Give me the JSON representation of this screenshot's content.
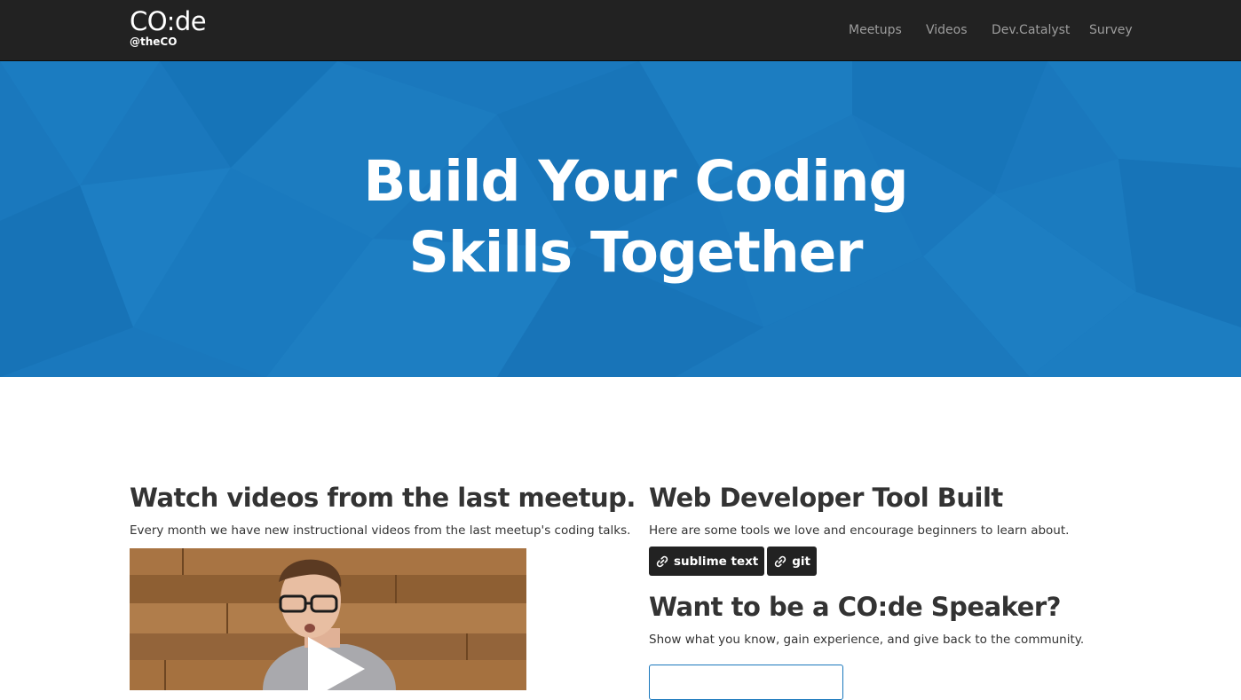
{
  "navbar": {
    "brand": {
      "name": "CO:de",
      "handle": "@theCO"
    },
    "items": [
      {
        "label": "Meetups"
      },
      {
        "label": "Videos"
      },
      {
        "label": "Dev.Catalyst"
      },
      {
        "label": "Survey"
      }
    ]
  },
  "hero": {
    "title_line1": "Build Your Coding",
    "title_line2": "Skills Together"
  },
  "videos": {
    "title": "Watch videos from the last meetup.",
    "description": "Every month we have new instructional videos from the last meetup's coding talks."
  },
  "tools": {
    "title": "Web Developer Tool Built",
    "description": "Here are some tools we love and encourage beginners to learn about.",
    "tags": [
      {
        "label": "sublime text",
        "icon": "link-icon"
      },
      {
        "label": "git",
        "icon": "link-icon"
      }
    ]
  },
  "speaker": {
    "title": "Want to be a CO:de Speaker?",
    "description": "Show what you know, gain experience, and give back to the community."
  },
  "colors": {
    "navbar_bg": "#222222",
    "hero_bg": "#1a78bd",
    "nav_text": "#9d9d9d",
    "tag_bg": "#222222",
    "heading_text": "#333333"
  }
}
